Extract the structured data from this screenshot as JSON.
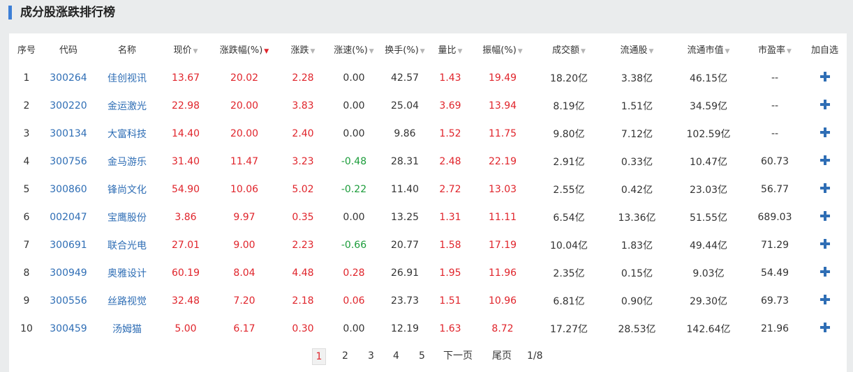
{
  "header": {
    "title": "成分股涨跌排行榜",
    "accent_color": "#3d7fd6"
  },
  "columns": [
    "序号",
    "代码",
    "名称",
    "现价",
    "涨跌幅(%)",
    "涨跌",
    "涨速(%)",
    "换手(%)",
    "量比",
    "振幅(%)",
    "成交额",
    "流通股",
    "流通市值",
    "市盈率",
    "加自选"
  ],
  "sort": {
    "active_column": "涨跌幅(%)",
    "direction": "descending"
  },
  "colors": {
    "up": "#e0242b",
    "down": "#1b9c3a",
    "code_link": "#2f6eb5"
  },
  "add_icon": "plus-icon",
  "rows": [
    [
      "1",
      "300264",
      "佳创视讯",
      "13.67",
      "20.02",
      "2.28",
      "0.00",
      "42.57",
      "1.43",
      "19.49",
      "18.20亿",
      "3.38亿",
      "46.15亿",
      "--"
    ],
    [
      "2",
      "300220",
      "金运激光",
      "22.98",
      "20.00",
      "3.83",
      "0.00",
      "25.04",
      "3.69",
      "13.94",
      "8.19亿",
      "1.51亿",
      "34.59亿",
      "--"
    ],
    [
      "3",
      "300134",
      "大富科技",
      "14.40",
      "20.00",
      "2.40",
      "0.00",
      "9.86",
      "1.52",
      "11.75",
      "9.80亿",
      "7.12亿",
      "102.59亿",
      "--"
    ],
    [
      "4",
      "300756",
      "金马游乐",
      "31.40",
      "11.47",
      "3.23",
      "-0.48",
      "28.31",
      "2.48",
      "22.19",
      "2.91亿",
      "0.33亿",
      "10.47亿",
      "60.73"
    ],
    [
      "5",
      "300860",
      "锋尚文化",
      "54.90",
      "10.06",
      "5.02",
      "-0.22",
      "11.40",
      "2.72",
      "13.03",
      "2.55亿",
      "0.42亿",
      "23.03亿",
      "56.77"
    ],
    [
      "6",
      "002047",
      "宝鹰股份",
      "3.86",
      "9.97",
      "0.35",
      "0.00",
      "13.25",
      "1.31",
      "11.11",
      "6.54亿",
      "13.36亿",
      "51.55亿",
      "689.03"
    ],
    [
      "7",
      "300691",
      "联合光电",
      "27.01",
      "9.00",
      "2.23",
      "-0.66",
      "20.77",
      "1.58",
      "17.19",
      "10.04亿",
      "1.83亿",
      "49.44亿",
      "71.29"
    ],
    [
      "8",
      "300949",
      "奥雅设计",
      "60.19",
      "8.04",
      "4.48",
      "0.28",
      "26.91",
      "1.95",
      "11.96",
      "2.35亿",
      "0.15亿",
      "9.03亿",
      "54.49"
    ],
    [
      "9",
      "300556",
      "丝路视觉",
      "32.48",
      "7.20",
      "2.18",
      "0.06",
      "23.73",
      "1.51",
      "10.96",
      "6.81亿",
      "0.90亿",
      "29.30亿",
      "69.73"
    ],
    [
      "10",
      "300459",
      "汤姆猫",
      "5.00",
      "6.17",
      "0.30",
      "0.00",
      "12.19",
      "1.63",
      "8.72",
      "17.27亿",
      "28.53亿",
      "142.64亿",
      "21.96"
    ]
  ],
  "pagination": {
    "pages": [
      "1",
      "2",
      "3",
      "4",
      "5"
    ],
    "current": "1",
    "next_label": "下一页",
    "last_label": "尾页",
    "total": "1/8"
  }
}
